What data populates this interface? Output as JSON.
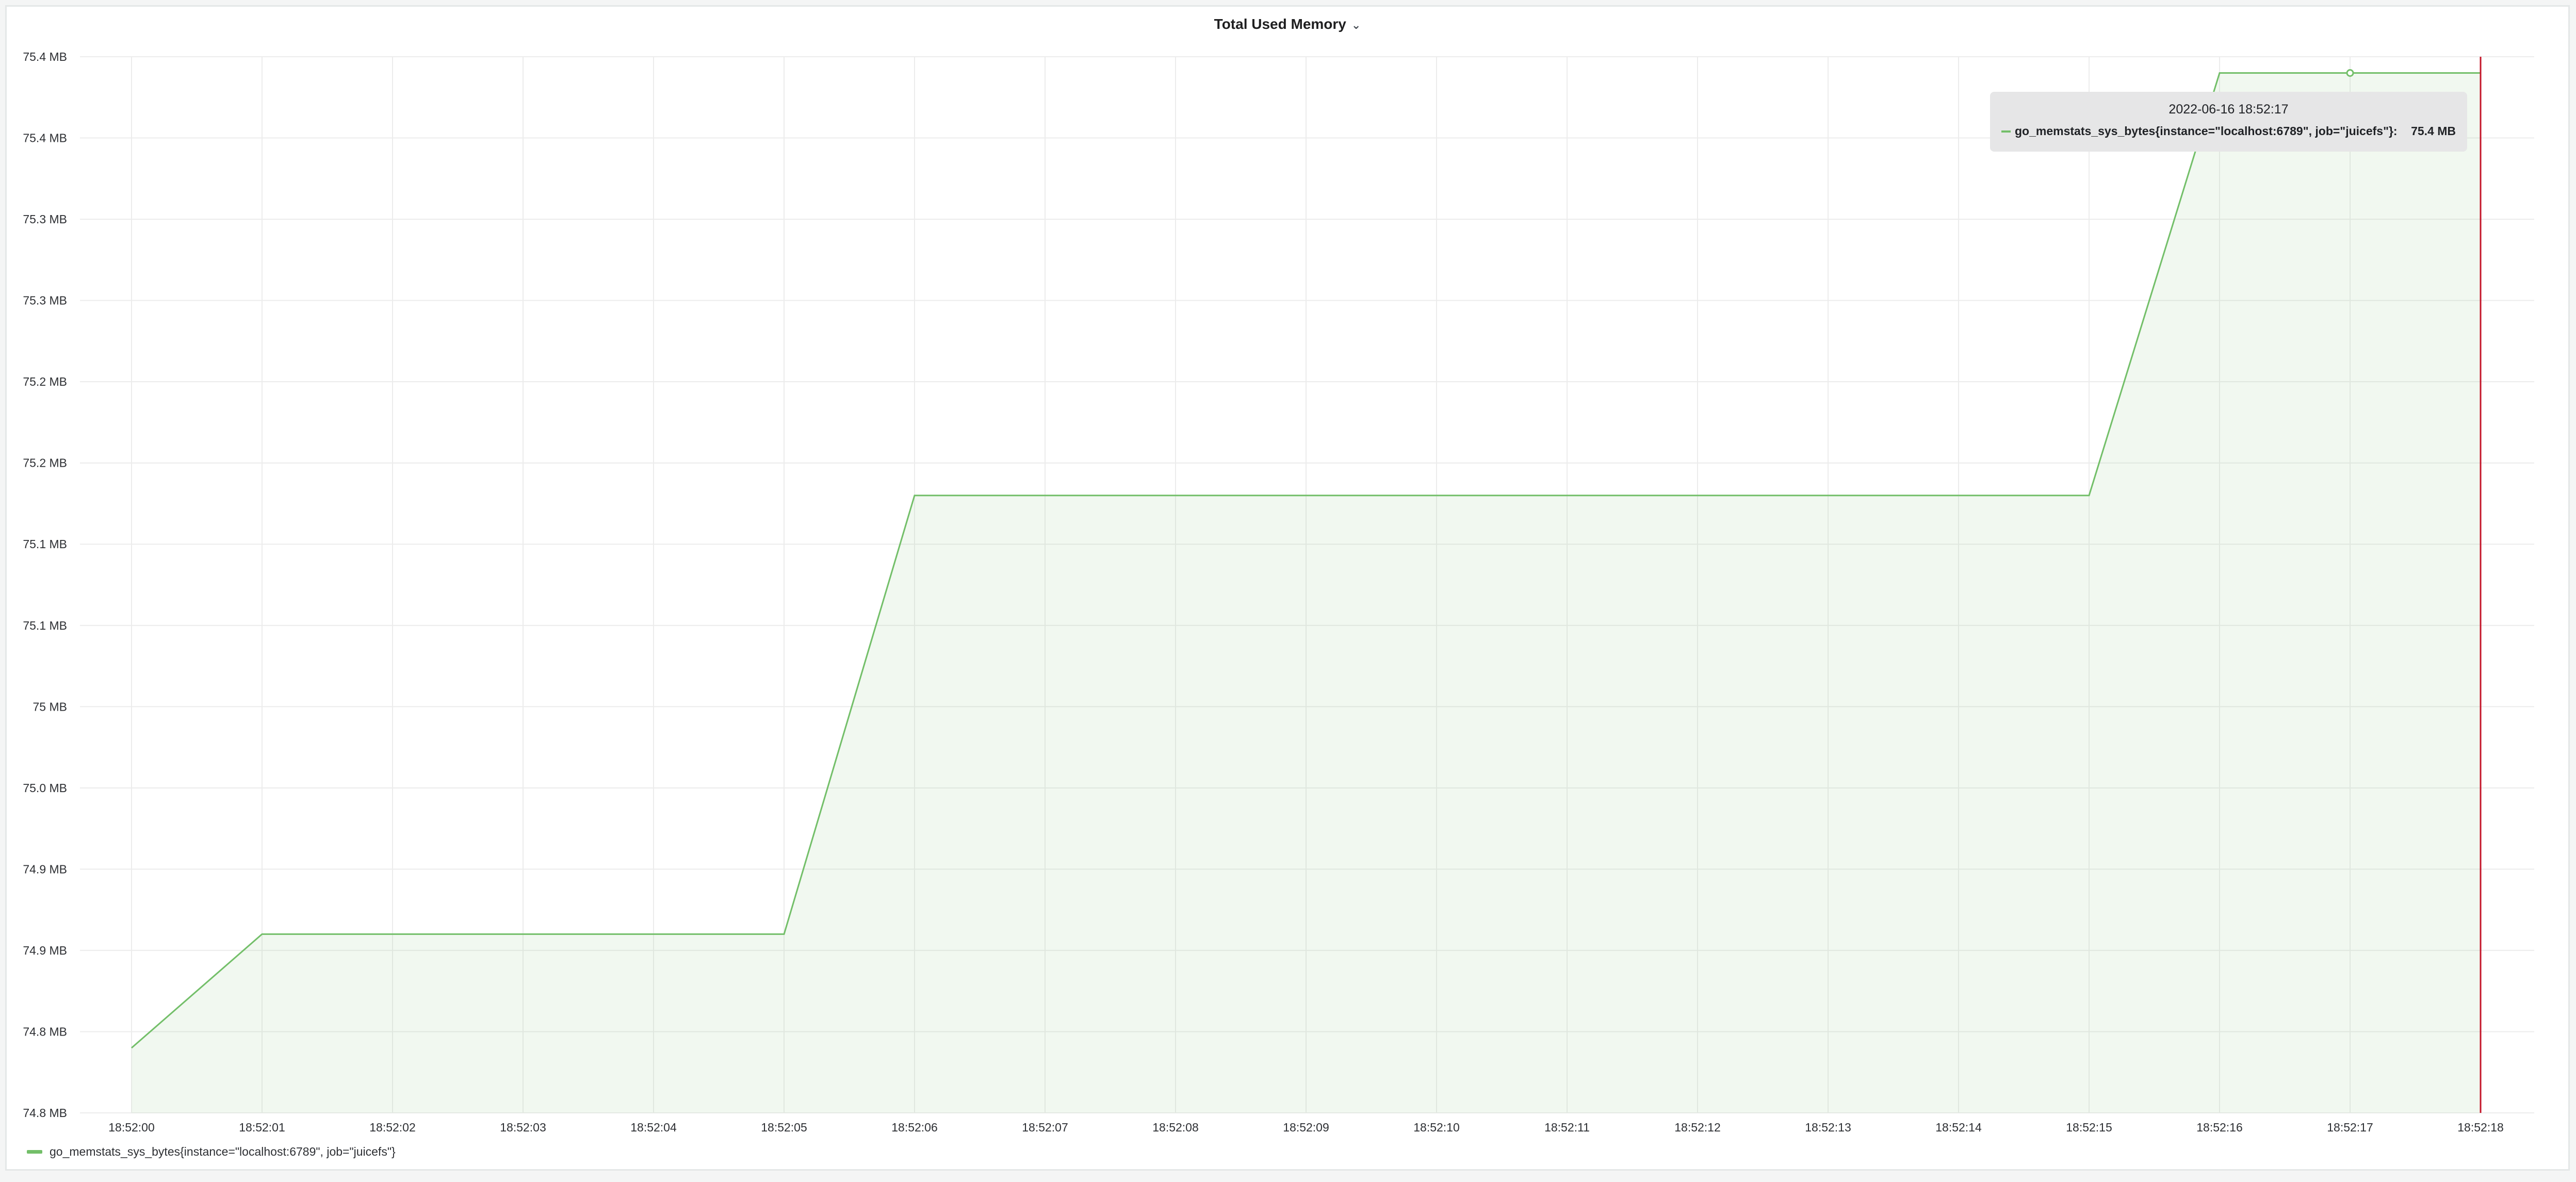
{
  "panel": {
    "title": "Total Used Memory",
    "title_icon": "chevron-down-icon"
  },
  "chart_data": {
    "type": "area",
    "title": "Total Used Memory",
    "xlabel": "",
    "ylabel": "",
    "y_unit": "MB",
    "ylim": [
      74.76,
      75.41
    ],
    "x_ticks": [
      "18:52:00",
      "18:52:01",
      "18:52:02",
      "18:52:03",
      "18:52:04",
      "18:52:05",
      "18:52:06",
      "18:52:07",
      "18:52:08",
      "18:52:09",
      "18:52:10",
      "18:52:11",
      "18:52:12",
      "18:52:13",
      "18:52:14",
      "18:52:15",
      "18:52:16",
      "18:52:17",
      "18:52:18"
    ],
    "y_ticks": [
      {
        "value": 74.76,
        "label": "74.8 MB"
      },
      {
        "value": 74.81,
        "label": "74.8 MB"
      },
      {
        "value": 74.86,
        "label": "74.9 MB"
      },
      {
        "value": 74.91,
        "label": "74.9 MB"
      },
      {
        "value": 74.96,
        "label": "75.0 MB"
      },
      {
        "value": 75.01,
        "label": "75 MB"
      },
      {
        "value": 75.06,
        "label": "75.1 MB"
      },
      {
        "value": 75.11,
        "label": "75.1 MB"
      },
      {
        "value": 75.16,
        "label": "75.2 MB"
      },
      {
        "value": 75.21,
        "label": "75.2 MB"
      },
      {
        "value": 75.26,
        "label": "75.3 MB"
      },
      {
        "value": 75.31,
        "label": "75.3 MB"
      },
      {
        "value": 75.36,
        "label": "75.4 MB"
      },
      {
        "value": 75.41,
        "label": "75.4 MB"
      }
    ],
    "series": [
      {
        "name": "go_memstats_sys_bytes{instance=\"localhost:6789\", job=\"juicefs\"}",
        "color": "#73bf69",
        "x": [
          "18:52:00",
          "18:52:01",
          "18:52:05",
          "18:52:06",
          "18:52:15",
          "18:52:16",
          "18:52:17",
          "18:52:18"
        ],
        "values": [
          74.8,
          74.87,
          74.87,
          75.14,
          75.14,
          75.4,
          75.4,
          75.4
        ]
      }
    ],
    "grid": true,
    "legend": "bottom-left",
    "cursor": {
      "x": "18:52:18",
      "color": "#c4162a"
    },
    "hover_point": {
      "x": "18:52:17",
      "value": 75.4
    }
  },
  "tooltip": {
    "time": "2022-06-16 18:52:17",
    "series_label": "go_memstats_sys_bytes{instance=\"localhost:6789\", job=\"juicefs\"}:",
    "value": "75.4 MB"
  },
  "legend": {
    "items": [
      {
        "label": "go_memstats_sys_bytes{instance=\"localhost:6789\", job=\"juicefs\"}",
        "color": "#73bf69"
      }
    ]
  }
}
